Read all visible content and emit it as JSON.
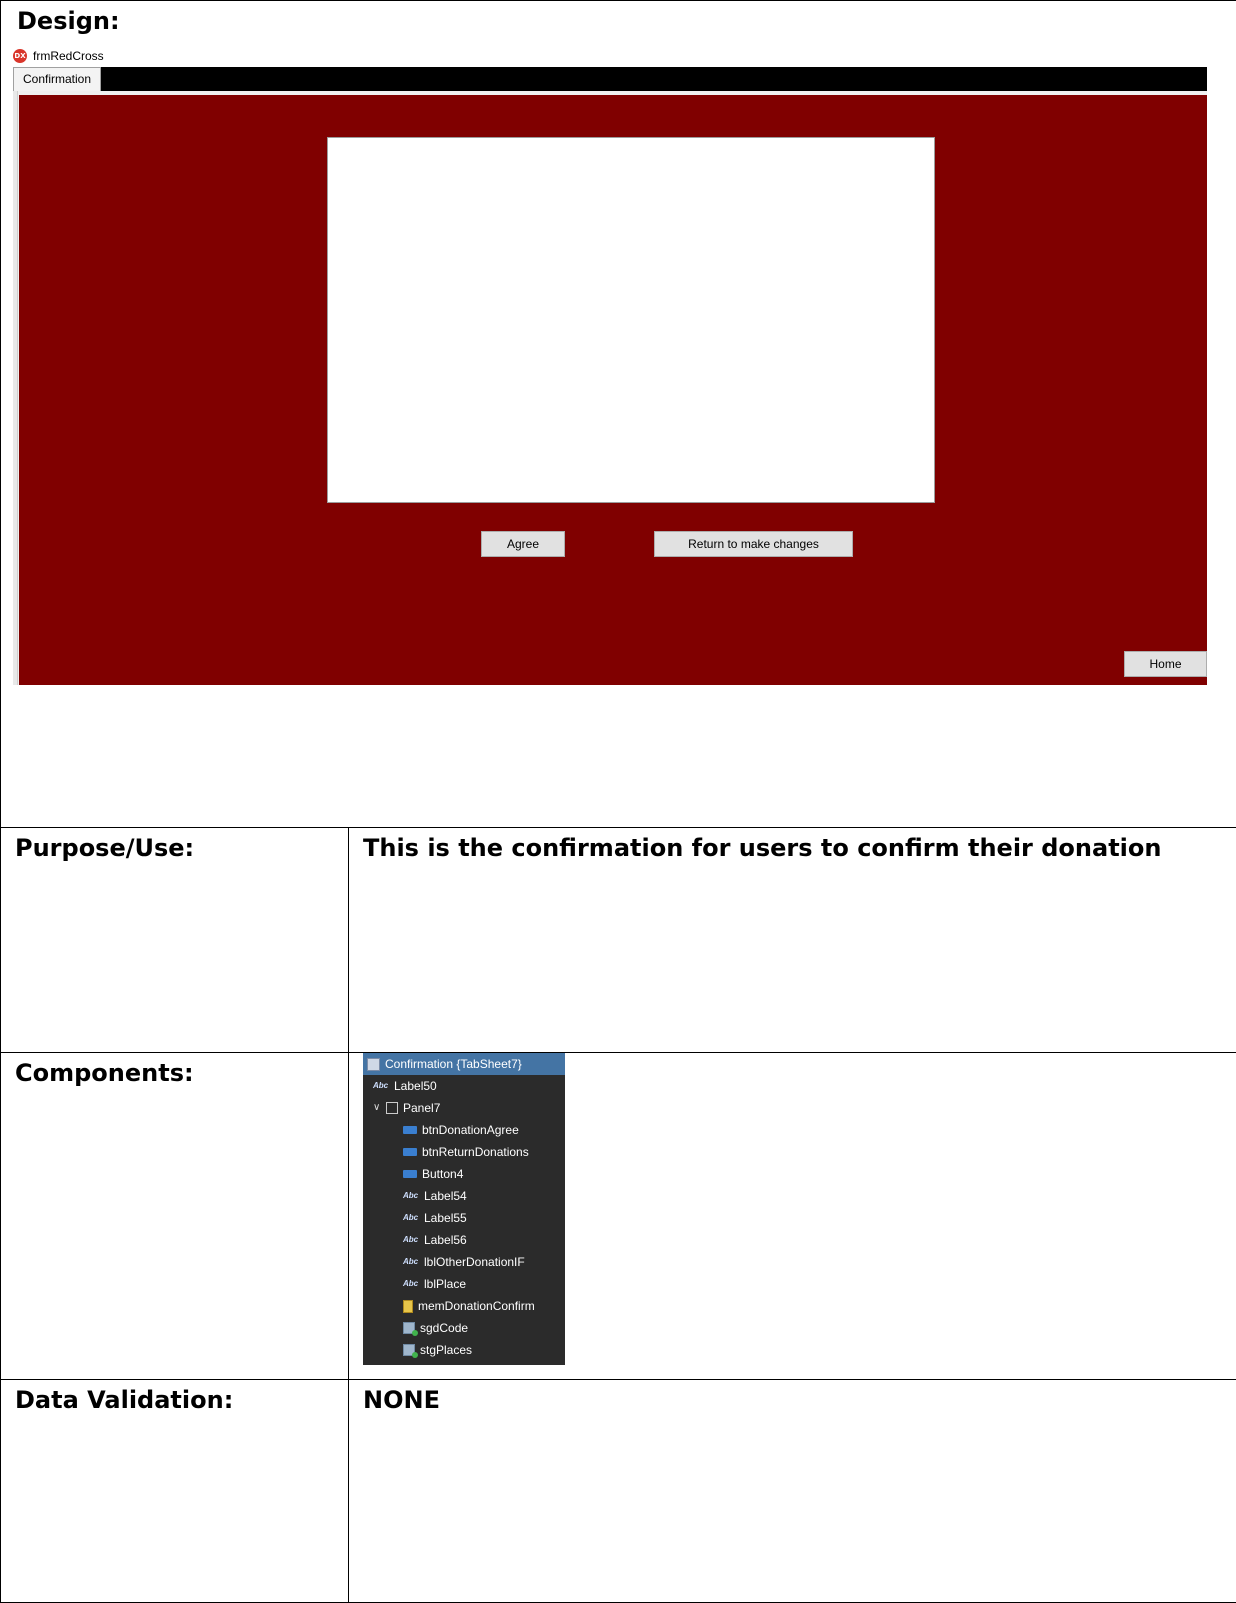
{
  "design": {
    "heading": "Design:",
    "window_title": "frmRedCross",
    "app_icon_text": "DX",
    "tab_label": "Confirmation",
    "buttons": {
      "agree": "Agree",
      "return": "Return to make changes",
      "home": "Home"
    },
    "colors": {
      "panel": "#800000",
      "tabstrip": "#000000"
    }
  },
  "purpose": {
    "label": "Purpose/Use:",
    "value": "This is the confirmation for users to confirm their donation"
  },
  "components": {
    "label": "Components:",
    "tree": [
      {
        "text": "Confirmation {TabSheet7}",
        "icon": "tabsheet-icon",
        "selected": true
      },
      {
        "text": "Label50",
        "icon": "label-icon"
      },
      {
        "text": "Panel7",
        "icon": "panel-icon",
        "expanded": true
      },
      {
        "text": "btnDonationAgree",
        "icon": "button-icon"
      },
      {
        "text": "btnReturnDonations",
        "icon": "button-icon"
      },
      {
        "text": "Button4",
        "icon": "button-icon"
      },
      {
        "text": "Label54",
        "icon": "label-icon"
      },
      {
        "text": "Label55",
        "icon": "label-icon"
      },
      {
        "text": "Label56",
        "icon": "label-icon"
      },
      {
        "text": "lblOtherDonationIF",
        "icon": "label-icon"
      },
      {
        "text": "lblPlace",
        "icon": "label-icon"
      },
      {
        "text": "memDonationConfirm",
        "icon": "memo-icon"
      },
      {
        "text": "sgdCode",
        "icon": "string-grid-icon"
      },
      {
        "text": "stgPlaces",
        "icon": "string-grid-icon"
      }
    ]
  },
  "validation": {
    "label": "Data Validation:",
    "value": "NONE"
  }
}
